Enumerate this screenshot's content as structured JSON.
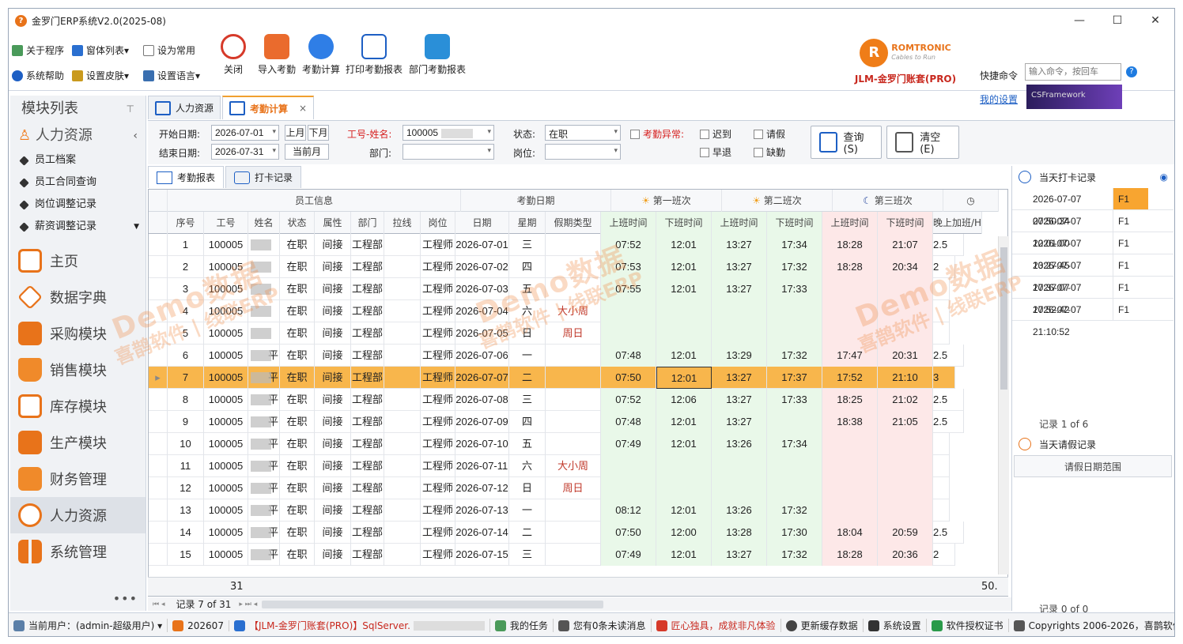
{
  "window": {
    "title": "金罗门ERP系统V2.0(2025-08)",
    "controls": [
      "—",
      "☐",
      "✕"
    ]
  },
  "ribbon": {
    "small": [
      "关于程序",
      "窗体列表",
      "设为常用",
      "系统帮助",
      "设置皮肤",
      "设置语言"
    ],
    "big": [
      "关闭",
      "导入考勤",
      "考勤计算",
      "打印考勤报表",
      "部门考勤报表"
    ],
    "brand_name": "ROMTRONIC",
    "brand_slogan": "Cables to Run",
    "brand_product": "JLM-金罗门账套(PRO)",
    "cmd_label": "快捷命令",
    "cmd_placeholder": "输入命令，按回车",
    "my_settings": "我的设置",
    "framework": "CSFramework"
  },
  "left": {
    "title": "模块列表",
    "group": "人力资源",
    "subs": [
      "员工档案",
      "员工合同查询",
      "岗位调整记录",
      "薪资调整记录"
    ],
    "modules": [
      "主页",
      "数据字典",
      "采购模块",
      "销售模块",
      "库存模块",
      "生产模块",
      "财务管理",
      "人力资源",
      "系统管理"
    ],
    "more": "•••"
  },
  "tabs": [
    {
      "label": "人力资源"
    },
    {
      "label": "考勤计算"
    }
  ],
  "filter": {
    "start_label": "开始日期:",
    "start": "2026-07-01",
    "end_label": "结束日期:",
    "end": "2026-07-31",
    "prev_month": "上月",
    "next_month": "下月",
    "cur_month": "当前月",
    "emp_label": "工号-姓名:",
    "emp": "100005",
    "dept_label": "部门:",
    "dept": "",
    "status_label": "状态:",
    "status": "在职",
    "post_label": "岗位:",
    "post": "",
    "abn_label": "考勤异常:",
    "late": "迟到",
    "leave": "请假",
    "early": "早退",
    "absent": "缺勤",
    "query": "查询(S)",
    "clear": "清空(E)"
  },
  "subtabs": [
    "考勤报表",
    "打卡记录"
  ],
  "grid": {
    "groups": [
      "员工信息",
      "考勤日期",
      "第一班次",
      "第二班次",
      "第三班次"
    ],
    "headers": [
      "序号",
      "工号",
      "姓名",
      "状态",
      "属性",
      "部门",
      "拉线",
      "岗位",
      "日期",
      "星期",
      "假期类型",
      "上班时间",
      "下班时间",
      "上班时间",
      "下班时间",
      "上班时间",
      "下班时间",
      "晚上加班/H"
    ],
    "rows": [
      [
        "1",
        "100005",
        "",
        "在职",
        "间接",
        "工程部",
        "",
        "工程师",
        "2026-07-01",
        "三",
        "",
        "07:52",
        "12:01",
        "13:27",
        "17:34",
        "18:28",
        "21:07",
        "2.5"
      ],
      [
        "2",
        "100005",
        "",
        "在职",
        "间接",
        "工程部",
        "",
        "工程师",
        "2026-07-02",
        "四",
        "",
        "07:53",
        "12:01",
        "13:27",
        "17:32",
        "18:28",
        "20:34",
        "2"
      ],
      [
        "3",
        "100005",
        "",
        "在职",
        "间接",
        "工程部",
        "",
        "工程师",
        "2026-07-03",
        "五",
        "",
        "07:55",
        "12:01",
        "13:27",
        "17:33",
        "",
        "",
        ""
      ],
      [
        "4",
        "100005",
        "",
        "在职",
        "间接",
        "工程部",
        "",
        "工程师",
        "2026-07-04",
        "六",
        "大小周",
        "",
        "",
        "",
        "",
        "",
        "",
        ""
      ],
      [
        "5",
        "100005",
        "",
        "在职",
        "间接",
        "工程部",
        "",
        "工程师",
        "2026-07-05",
        "日",
        "周日",
        "",
        "",
        "",
        "",
        "",
        "",
        ""
      ],
      [
        "6",
        "100005",
        "平",
        "在职",
        "间接",
        "工程部",
        "",
        "工程师",
        "2026-07-06",
        "一",
        "",
        "07:48",
        "12:01",
        "13:29",
        "17:32",
        "17:47",
        "20:31",
        "2.5"
      ],
      [
        "7",
        "100005",
        "平",
        "在职",
        "间接",
        "工程部",
        "",
        "工程师",
        "2026-07-07",
        "二",
        "",
        "07:50",
        "12:01",
        "13:27",
        "17:37",
        "17:52",
        "21:10",
        "3"
      ],
      [
        "8",
        "100005",
        "平",
        "在职",
        "间接",
        "工程部",
        "",
        "工程师",
        "2026-07-08",
        "三",
        "",
        "07:52",
        "12:06",
        "13:27",
        "17:33",
        "18:25",
        "21:02",
        "2.5"
      ],
      [
        "9",
        "100005",
        "平",
        "在职",
        "间接",
        "工程部",
        "",
        "工程师",
        "2026-07-09",
        "四",
        "",
        "07:48",
        "12:01",
        "13:27",
        "",
        "18:38",
        "21:05",
        "2.5"
      ],
      [
        "10",
        "100005",
        "平",
        "在职",
        "间接",
        "工程部",
        "",
        "工程师",
        "2026-07-10",
        "五",
        "",
        "07:49",
        "12:01",
        "13:26",
        "17:34",
        "",
        "",
        ""
      ],
      [
        "11",
        "100005",
        "平",
        "在职",
        "间接",
        "工程部",
        "",
        "工程师",
        "2026-07-11",
        "六",
        "大小周",
        "",
        "",
        "",
        "",
        "",
        "",
        ""
      ],
      [
        "12",
        "100005",
        "平",
        "在职",
        "间接",
        "工程部",
        "",
        "工程师",
        "2026-07-12",
        "日",
        "周日",
        "",
        "",
        "",
        "",
        "",
        "",
        ""
      ],
      [
        "13",
        "100005",
        "平",
        "在职",
        "间接",
        "工程部",
        "",
        "工程师",
        "2026-07-13",
        "一",
        "",
        "08:12",
        "12:01",
        "13:26",
        "17:32",
        "",
        "",
        ""
      ],
      [
        "14",
        "100005",
        "平",
        "在职",
        "间接",
        "工程部",
        "",
        "工程师",
        "2026-07-14",
        "二",
        "",
        "07:50",
        "12:00",
        "13:28",
        "17:30",
        "18:04",
        "20:59",
        "2.5"
      ],
      [
        "15",
        "100005",
        "平",
        "在职",
        "间接",
        "工程部",
        "",
        "工程师",
        "2026-07-15",
        "三",
        "",
        "07:49",
        "12:01",
        "13:27",
        "17:32",
        "18:28",
        "20:36",
        "2"
      ]
    ],
    "footer_count": "31",
    "footer_sum": "50.",
    "nav": "记录 7 of 31"
  },
  "right": {
    "title": "当天打卡记录",
    "punches": [
      [
        "2026-07-07 07:50:34",
        "F1"
      ],
      [
        "2026-07-07 12:01:00",
        "F1"
      ],
      [
        "2026-07-07 13:27:45",
        "F1"
      ],
      [
        "2026-07-07 17:37:07",
        "F1"
      ],
      [
        "2026-07-07 17:52:42",
        "F1"
      ],
      [
        "2026-07-07 21:10:52",
        "F1"
      ]
    ],
    "nav": "记录 1 of 6",
    "leave_title": "当天请假记录",
    "leave_col": "请假日期范围",
    "leave_nav": "记录 0 of 0"
  },
  "status": [
    "当前用户：(admin-超级用户) ▾",
    "202607",
    "【JLM-金罗门账套(PRO)】SqlServer.",
    "我的任务",
    "您有0条未读消息",
    "匠心独具，成就非凡体验",
    "更新缓存数据",
    "系统设置",
    "软件授权证书",
    "Copyrights 2006-2026，喜鹊软件"
  ],
  "watermark": {
    "line1": "Demo数据",
    "line2": "喜鹊软件 | 线联ERP"
  },
  "colors": {
    "accent": "#e8731a",
    "selected_row": "#f8b64c",
    "shift_green": "#e9f8e9",
    "shift_pink": "#fde8e8"
  }
}
